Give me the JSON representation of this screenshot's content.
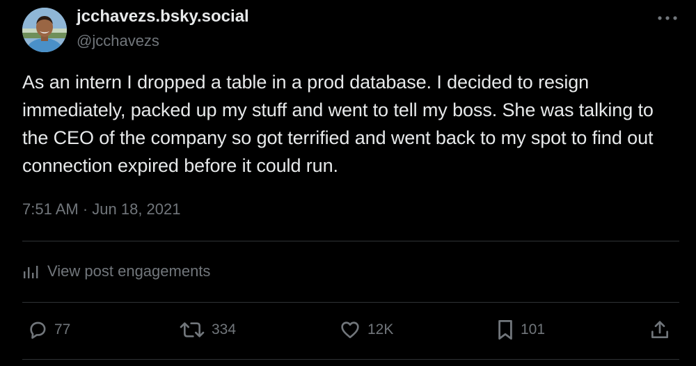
{
  "post": {
    "author": {
      "display_name": "jcchavezs.bsky.social",
      "handle": "@jcchavezs"
    },
    "text": "As an intern I dropped a table in a prod database. I decided to resign immediately, packed up my stuff and went to tell my boss. She was talking to the CEO of the company so got terrified and went back to my spot to find out connection expired before it could run.",
    "timestamp": "7:51 AM · Jun 18, 2021",
    "engagements_label": "View post engagements",
    "actions": {
      "replies": "77",
      "reposts": "334",
      "likes": "12K",
      "bookmarks": "101"
    }
  },
  "icons": {
    "more": "more-horizontal-icon",
    "analytics": "bar-chart-icon",
    "reply": "reply-icon",
    "repost": "repost-icon",
    "like": "heart-icon",
    "bookmark": "bookmark-icon",
    "share": "share-icon"
  },
  "colors": {
    "background": "#000000",
    "text_primary": "#e7e9ea",
    "text_secondary": "#71767b",
    "divider": "#2f3336"
  }
}
